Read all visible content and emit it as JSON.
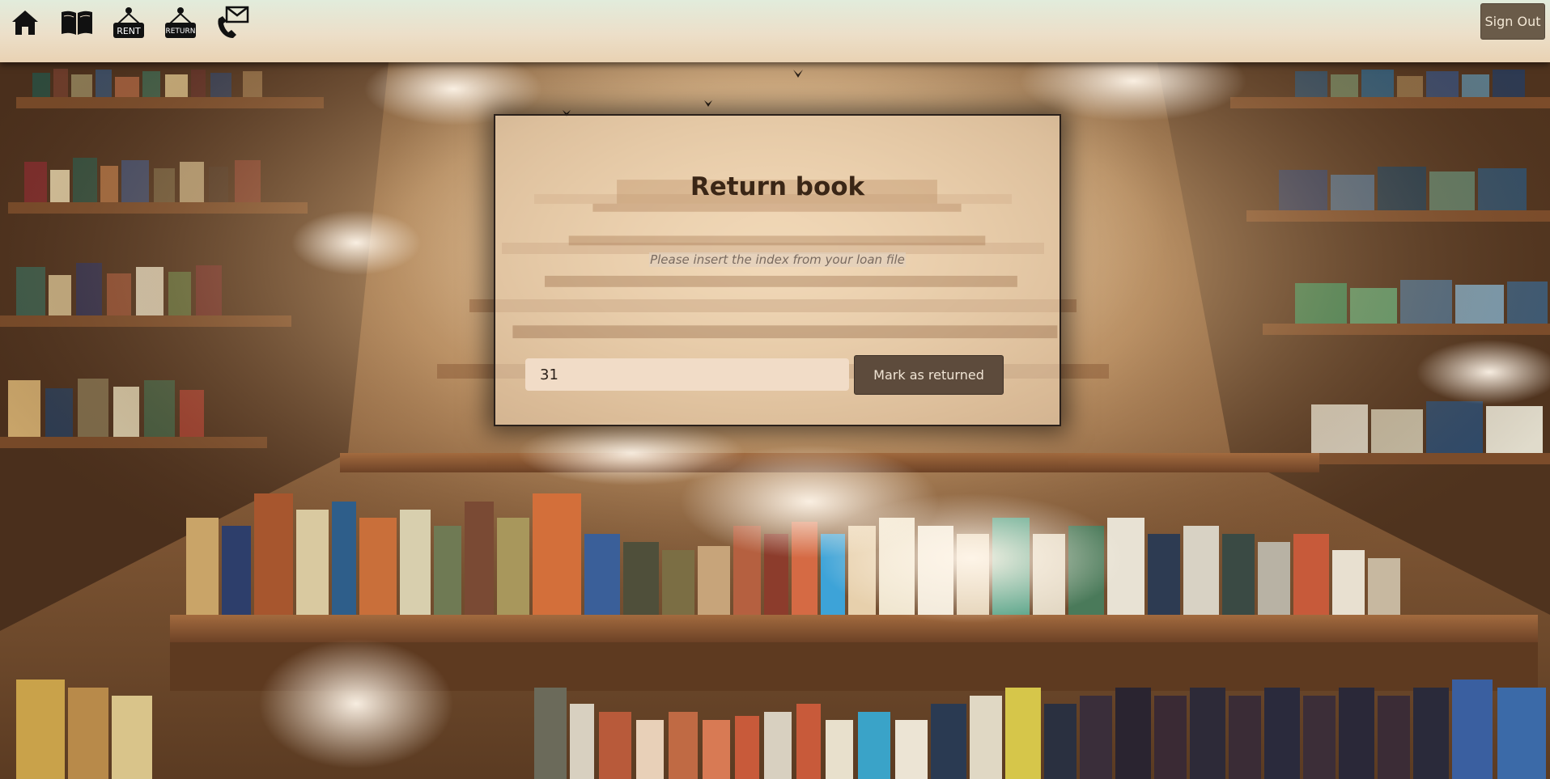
{
  "header": {
    "nav": [
      {
        "icon": "home-icon",
        "name": "home-nav-button"
      },
      {
        "icon": "book-icon",
        "name": "books-nav-button"
      },
      {
        "icon": "rent-sign-icon",
        "name": "rent-nav-button",
        "label": "RENT"
      },
      {
        "icon": "return-sign-icon",
        "name": "return-nav-button",
        "label": "RETURN"
      },
      {
        "icon": "phone-mail-icon",
        "name": "contact-nav-button"
      }
    ],
    "sign_out_label": "Sign Out"
  },
  "panel": {
    "title": "Return book",
    "hint": "Please insert the index from your loan file",
    "index_value": "31",
    "submit_label": "Mark as returned"
  },
  "colors": {
    "header_top": "#e2ecdc",
    "header_bottom": "#e9d2b3",
    "button_dark": "#5d4b3c",
    "sign_out": "#6a5b49",
    "input_bg": "#f1dcc7",
    "title": "#3a2616"
  }
}
